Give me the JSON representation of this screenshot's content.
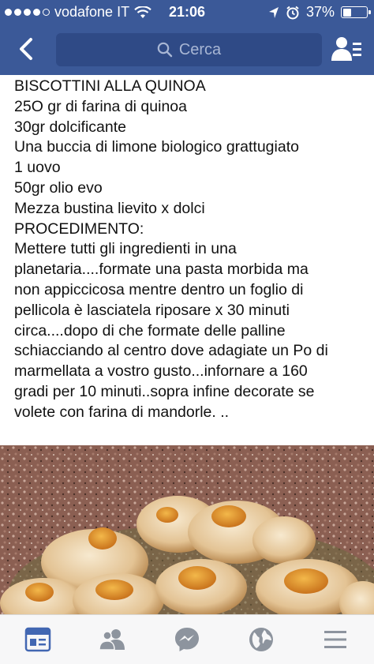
{
  "status_bar": {
    "carrier": "vodafone IT",
    "time": "21:06",
    "battery": "37%",
    "battery_level": 0.37,
    "signal_bars_filled": 4,
    "signal_bars_total": 5
  },
  "nav": {
    "back_icon": "chevron-left-icon",
    "search_placeholder": "Cerca",
    "search_icon": "search-icon",
    "friend_requests_icon": "friend-requests-icon"
  },
  "post": {
    "lines": [
      "BISCOTTINI ALLA QUINOA",
      "25O gr di farina di quinoa",
      "30gr dolcificante",
      "Una buccia di limone biologico grattugiato",
      "1 uovo",
      "50gr olio evo",
      "Mezza bustina lievito x dolci",
      "PROCEDIMENTO:",
      "Mettere tutti gli ingredienti in una",
      "planetaria....formate una pasta morbida ma",
      "non appiccicosa mentre dentro un foglio di",
      "pellicola è lasciatela riposare x 30 minuti",
      "circa....dopo di che formate delle palline",
      "schiacciando al centro dove adagiate un Po di",
      "marmellata a vostro gusto...infornare a 160",
      "gradi per 10 minuti..sopra infine decorate se",
      "volete con farina di mandorle. .."
    ]
  },
  "photo": {
    "subject": "thumbprint-cookies-photo"
  },
  "tabbar": {
    "tabs": [
      {
        "icon": "news-feed-icon",
        "active": true
      },
      {
        "icon": "friends-icon",
        "active": false
      },
      {
        "icon": "messenger-icon",
        "active": false
      },
      {
        "icon": "globe-icon",
        "active": false
      },
      {
        "icon": "menu-icon",
        "active": false
      }
    ],
    "active_color": "#4267b2",
    "inactive_color": "#8d949e"
  },
  "colors": {
    "nav_blue": "#3b5998",
    "search_bg": "#2f4a86"
  }
}
